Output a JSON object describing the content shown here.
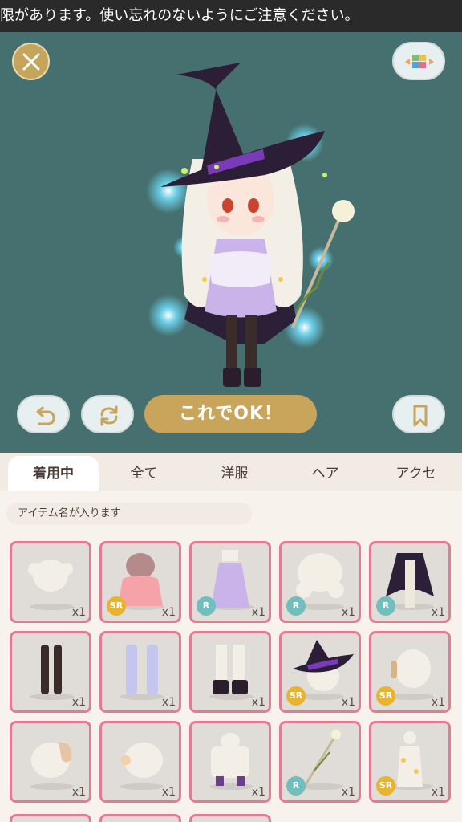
{
  "notice": {
    "text": "限があります。使い忘れのないようにご注意ください。"
  },
  "toolbar": {
    "close_icon": "close-icon",
    "background_icon": "color-swatches-icon",
    "undo_icon": "undo-icon",
    "redo_icon": "refresh-icon",
    "bookmark_icon": "bookmark-icon",
    "ok_label": "これでOK！"
  },
  "tabs": [
    {
      "label": "着用中",
      "active": true
    },
    {
      "label": "全て",
      "active": false
    },
    {
      "label": "洋服",
      "active": false
    },
    {
      "label": "ヘア",
      "active": false
    },
    {
      "label": "アクセ",
      "active": false
    }
  ],
  "item_name_bar": {
    "text": "アイテム名が入ります"
  },
  "items": [
    {
      "name": "hair-bun-icon",
      "rarity": "",
      "qty": "x1"
    },
    {
      "name": "pink-sweater-icon",
      "rarity": "SR",
      "qty": "x1"
    },
    {
      "name": "purple-dress-icon",
      "rarity": "R",
      "qty": "x1"
    },
    {
      "name": "curly-hair-icon",
      "rarity": "R",
      "qty": "x1"
    },
    {
      "name": "black-cape-icon",
      "rarity": "R",
      "qty": "x1"
    },
    {
      "name": "black-tights-icon",
      "rarity": "",
      "qty": "x1"
    },
    {
      "name": "lavender-socks-icon",
      "rarity": "",
      "qty": "x1"
    },
    {
      "name": "black-boots-icon",
      "rarity": "",
      "qty": "x1"
    },
    {
      "name": "witch-hat-icon",
      "rarity": "SR",
      "qty": "x1"
    },
    {
      "name": "headphones-icon",
      "rarity": "SR",
      "qty": "x1"
    },
    {
      "name": "side-ponytail-icon",
      "rarity": "",
      "qty": "x1"
    },
    {
      "name": "hair-clip-icon",
      "rarity": "",
      "qty": "x1"
    },
    {
      "name": "purple-shoes-icon",
      "rarity": "",
      "qty": "x1"
    },
    {
      "name": "flower-staff-icon",
      "rarity": "R",
      "qty": "x1"
    },
    {
      "name": "sparkle-effect-icon",
      "rarity": "SR",
      "qty": "x1"
    }
  ],
  "colors": {
    "stage": "#45706f",
    "accent_gold": "#c9a55b",
    "cell_border": "#e27b93",
    "badge_sr": "#e9b32b",
    "badge_r": "#6fbfbe"
  }
}
